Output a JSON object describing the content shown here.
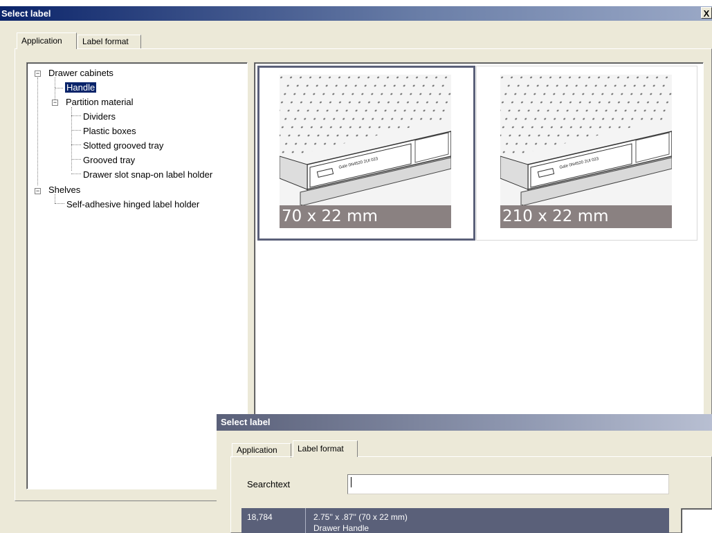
{
  "window": {
    "title": "Select label",
    "close_glyph": "X",
    "tabs": [
      {
        "label": "Application",
        "active": true
      },
      {
        "label": "Label format",
        "active": false
      }
    ]
  },
  "tree": {
    "items": [
      {
        "label": "Drawer cabinets",
        "expander": "−"
      },
      {
        "label": "Handle",
        "selected": true
      },
      {
        "label": "Partition material",
        "expander": "−"
      },
      {
        "label": "Dividers"
      },
      {
        "label": "Plastic boxes"
      },
      {
        "label": "Slotted grooved tray"
      },
      {
        "label": "Grooved tray"
      },
      {
        "label": "Drawer slot snap-on label holder"
      },
      {
        "label": "Shelves",
        "expander": "−"
      },
      {
        "label": "Self-adhesive hinged label holder"
      }
    ]
  },
  "thumbnails": [
    {
      "caption": "70 x 22 mm",
      "selected": true,
      "label_text": "Gale 0N4520 2UI 023"
    },
    {
      "caption": "210 x 22 mm",
      "selected": false,
      "label_text": "Gale 0N4520 2UI 023"
    }
  ],
  "dialog2": {
    "title": "Select label",
    "tabs": [
      {
        "label": "Application",
        "active": false
      },
      {
        "label": "Label format",
        "active": true
      }
    ],
    "search": {
      "label": "Searchtext",
      "value": ""
    },
    "results": [
      {
        "number": "18,784",
        "size": "2.75'' x .87'' (70 x 22 mm)",
        "description": "Drawer Handle"
      }
    ]
  },
  "colors": {
    "dialog_bg": "#ece9d8",
    "title_gradient_start": "#0b246a",
    "selection": "#0a246a",
    "thumb_caption_bg": "#8a8181",
    "result_row_bg": "#5a6079"
  }
}
